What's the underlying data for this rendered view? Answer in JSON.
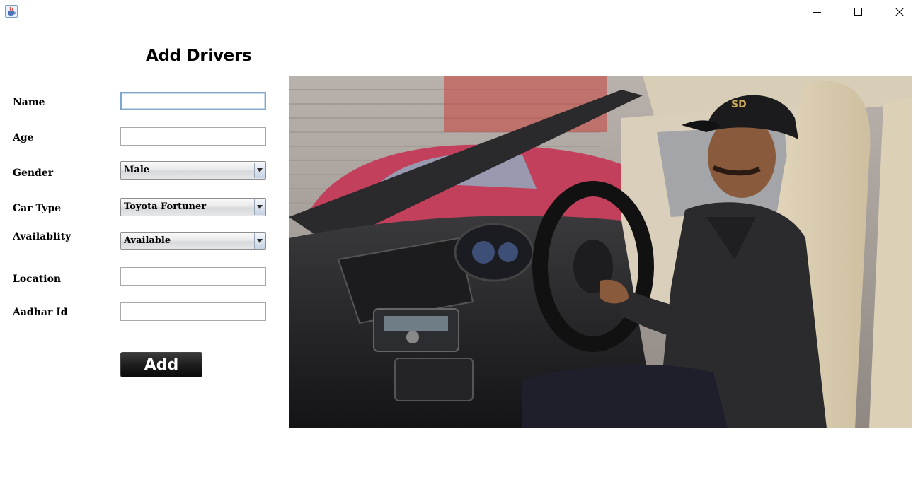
{
  "window": {
    "icon": "java-cup-icon",
    "controls": [
      "minimize-icon",
      "maximize-icon",
      "close-icon"
    ]
  },
  "form": {
    "title": "Add Drivers",
    "fields": {
      "name": {
        "label": "Name",
        "value": ""
      },
      "age": {
        "label": "Age",
        "value": ""
      },
      "gender": {
        "label": "Gender",
        "selected": "Male"
      },
      "car_type": {
        "label": "Car Type",
        "selected": "Toyota Fortuner"
      },
      "availability": {
        "label": "Availablity",
        "selected": "Available"
      },
      "location": {
        "label": "Location",
        "value": ""
      },
      "aadhar_id": {
        "label": "Aadhar Id",
        "value": ""
      }
    },
    "add_label": "Add"
  },
  "colors": {
    "button_dark": "#1e1e1e",
    "focus_border": "#7ea7cf",
    "field_border": "#a9a9a9"
  }
}
